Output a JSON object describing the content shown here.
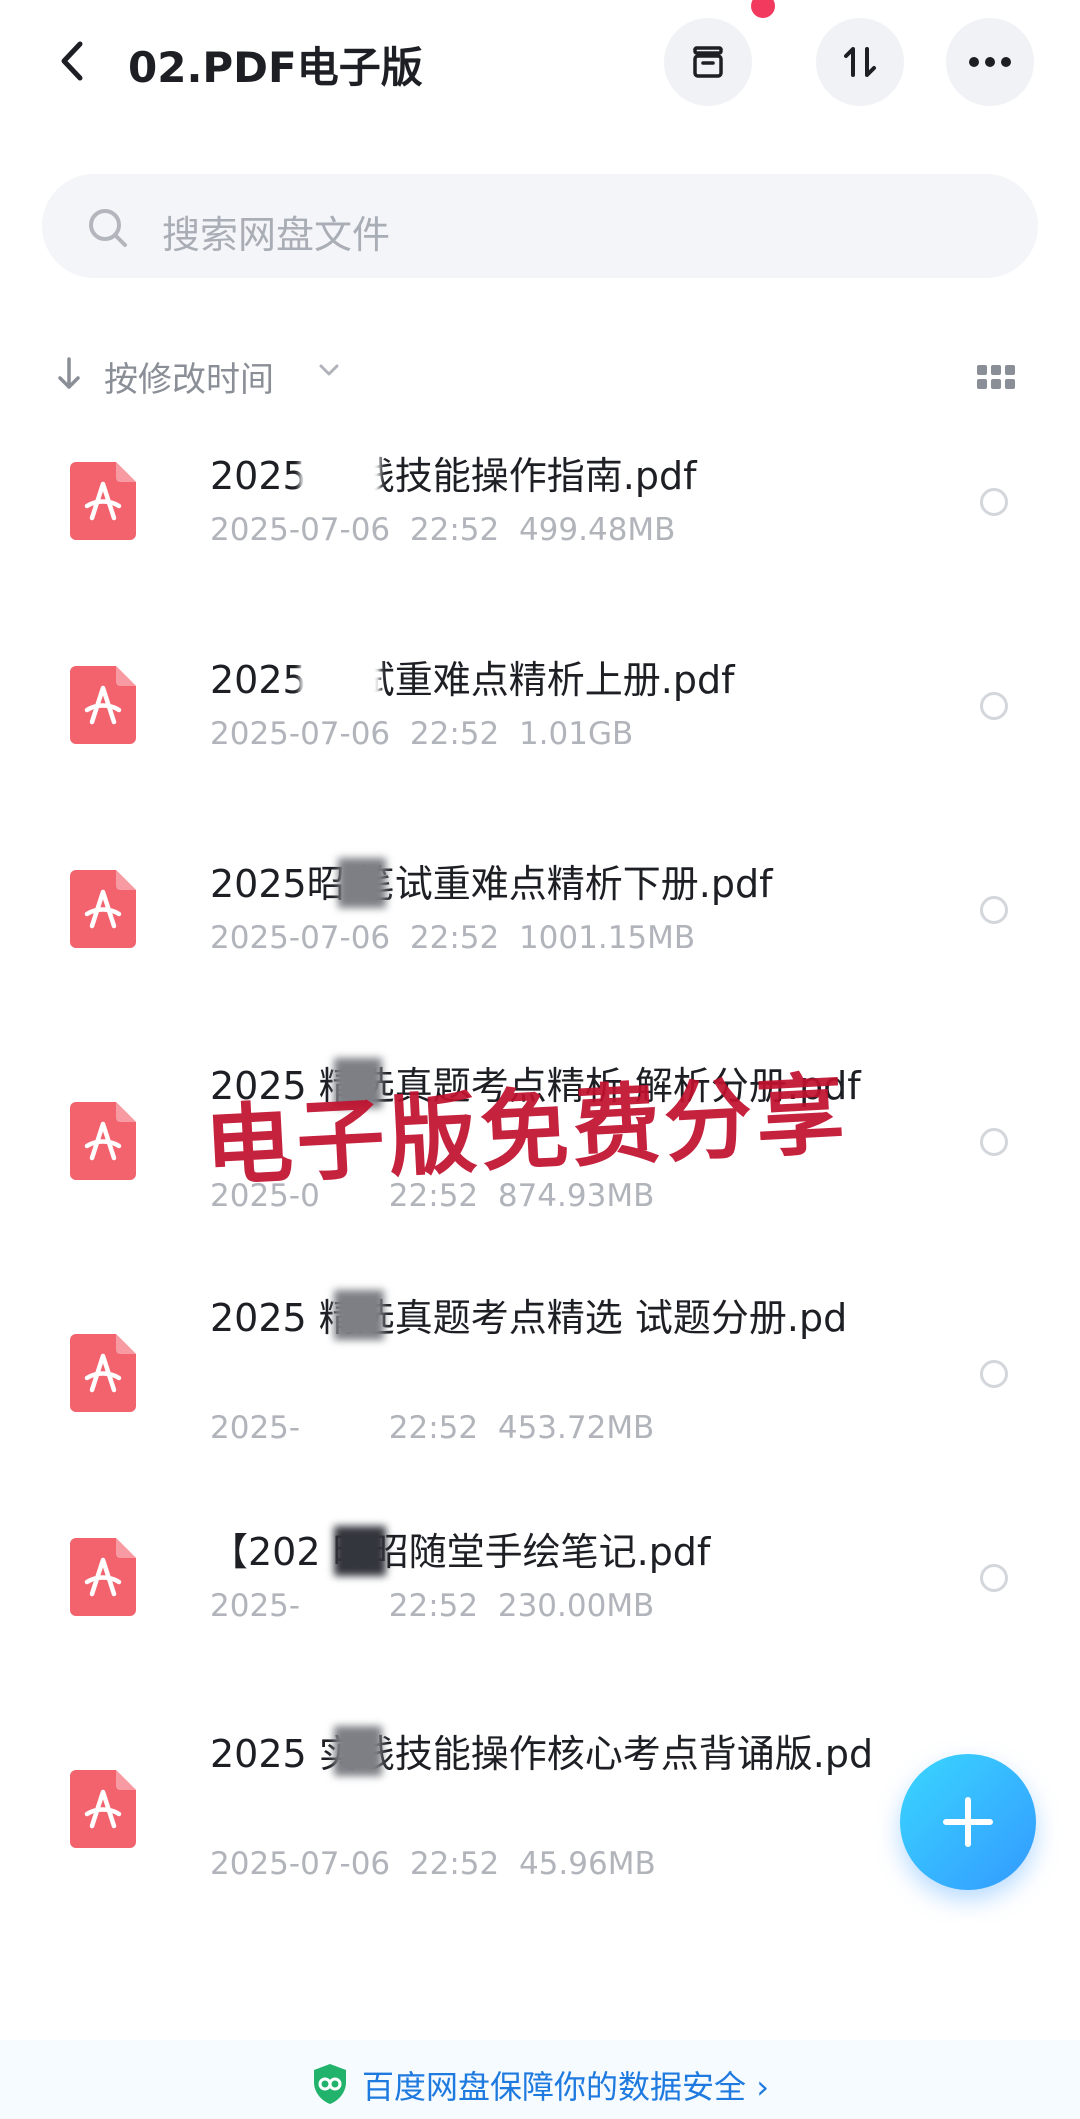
{
  "header": {
    "title": "02.PDF电子版",
    "back_icon": "chevron-left-icon",
    "archive_icon": "archive-box-icon",
    "sort_icon": "sort-updown-icon",
    "more_icon": "more-dots-icon"
  },
  "search": {
    "placeholder": "搜索网盘文件"
  },
  "sort": {
    "label": "按修改时间"
  },
  "files": [
    {
      "name": "2025 实践技能操作指南.pdf",
      "date": "2025-07-06",
      "time": "22:52",
      "size": "499.48MB"
    },
    {
      "name": "2025 笔试重难点精析上册.pdf",
      "date": "2025-07-06",
      "time": "22:52",
      "size": "1.01GB"
    },
    {
      "name": "2025昭 笔试重难点精析下册.pdf",
      "date": "2025-07-06",
      "time": "22:52",
      "size": "1001.15MB"
    },
    {
      "name": "2025 精选真题考点精析 解析分册.pdf",
      "date": "2025-0",
      "time": "22:52",
      "size": "874.93MB"
    },
    {
      "name": "2025 精选真题考点精选 试题分册.pd",
      "date": "2025-",
      "time": "22:52",
      "size": "453.72MB"
    },
    {
      "name": "【202 昭昭随堂手绘笔记.pdf",
      "date": "2025-",
      "time": "22:52",
      "size": "230.00MB"
    },
    {
      "name": "2025 实践技能操作核心考点背诵版.pd",
      "date": "2025-07-06",
      "time": "22:52",
      "size": "45.96MB"
    }
  ],
  "watermark": "电子版免费分享",
  "footer": {
    "text": "百度网盘保障你的数据安全",
    "arrow": "›"
  },
  "colors": {
    "pdf_icon": "#f2636e",
    "accent": "#1f7ae0",
    "watermark": "#c1102e",
    "notification": "#f23a5e"
  }
}
